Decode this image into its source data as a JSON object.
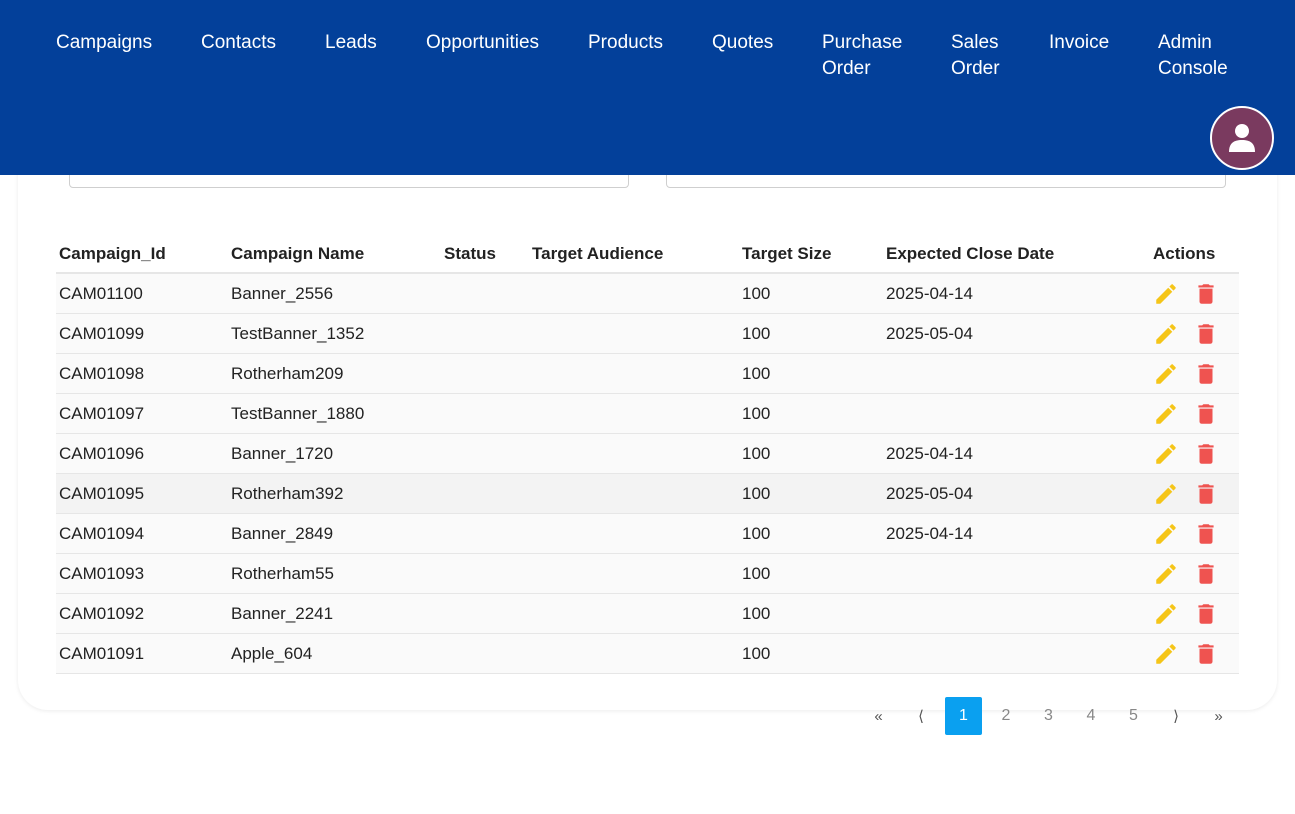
{
  "nav": {
    "items": [
      {
        "label": "Campaigns",
        "lines": [
          "Campaigns"
        ]
      },
      {
        "label": "Contacts",
        "lines": [
          "Contacts"
        ]
      },
      {
        "label": "Leads",
        "lines": [
          "Leads"
        ]
      },
      {
        "label": "Opportunities",
        "lines": [
          "Opportunities"
        ]
      },
      {
        "label": "Products",
        "lines": [
          "Products"
        ]
      },
      {
        "label": "Quotes",
        "lines": [
          "Quotes"
        ]
      },
      {
        "label": "Purchase Order",
        "lines": [
          "Purchase",
          "Order"
        ]
      },
      {
        "label": "Sales Order",
        "lines": [
          "Sales",
          "Order"
        ]
      },
      {
        "label": "Invoice",
        "lines": [
          "Invoice"
        ]
      },
      {
        "label": "Admin Console",
        "lines": [
          "Admin",
          "Console"
        ]
      }
    ],
    "bg_color": "#03409a",
    "avatar_color": "#7a3a5f",
    "avatar_icon": "user-icon"
  },
  "search": {
    "left_placeholder": "",
    "right_placeholder": ""
  },
  "table": {
    "columns": [
      "Campaign_Id",
      "Campaign Name",
      "Status",
      "Target Audience",
      "Target Size",
      "Expected Close Date",
      "Actions"
    ],
    "rows": [
      {
        "id": "CAM01100",
        "name": "Banner_2556",
        "status": "",
        "audience": "",
        "size": "100",
        "close_date": "2025-04-14"
      },
      {
        "id": "CAM01099",
        "name": "TestBanner_1352",
        "status": "",
        "audience": "",
        "size": "100",
        "close_date": "2025-05-04"
      },
      {
        "id": "CAM01098",
        "name": "Rotherham209",
        "status": "",
        "audience": "",
        "size": "100",
        "close_date": ""
      },
      {
        "id": "CAM01097",
        "name": "TestBanner_1880",
        "status": "",
        "audience": "",
        "size": "100",
        "close_date": ""
      },
      {
        "id": "CAM01096",
        "name": "Banner_1720",
        "status": "",
        "audience": "",
        "size": "100",
        "close_date": "2025-04-14"
      },
      {
        "id": "CAM01095",
        "name": "Rotherham392",
        "status": "",
        "audience": "",
        "size": "100",
        "close_date": "2025-05-04"
      },
      {
        "id": "CAM01094",
        "name": "Banner_2849",
        "status": "",
        "audience": "",
        "size": "100",
        "close_date": "2025-04-14"
      },
      {
        "id": "CAM01093",
        "name": "Rotherham55",
        "status": "",
        "audience": "",
        "size": "100",
        "close_date": ""
      },
      {
        "id": "CAM01092",
        "name": "Banner_2241",
        "status": "",
        "audience": "",
        "size": "100",
        "close_date": ""
      },
      {
        "id": "CAM01091",
        "name": "Apple_604",
        "status": "",
        "audience": "",
        "size": "100",
        "close_date": ""
      }
    ],
    "highlighted_row": 5,
    "edit_icon": "pencil-icon",
    "delete_icon": "trash-icon",
    "edit_color": "#f5c518",
    "delete_color": "#ef5350"
  },
  "pagination": {
    "first": "«",
    "prev": "⟨",
    "pages": [
      "1",
      "2",
      "3",
      "4",
      "5"
    ],
    "current": "1",
    "next": "⟩",
    "last": "»",
    "active_color": "#0aa0f0"
  }
}
